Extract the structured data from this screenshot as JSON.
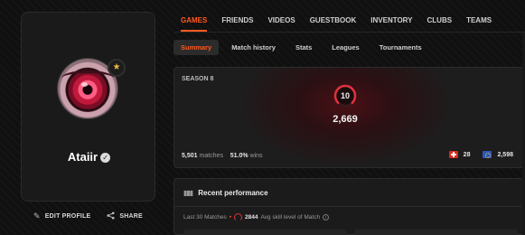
{
  "profile": {
    "name": "Ataiir",
    "level_badge_icon": "star",
    "actions": [
      {
        "label": "EDIT PROFILE",
        "icon": "pencil-icon"
      },
      {
        "label": "SHARE",
        "icon": "share-icon"
      }
    ]
  },
  "top_nav": {
    "tabs": [
      "GAMES",
      "FRIENDS",
      "VIDEOS",
      "GUESTBOOK",
      "INVENTORY",
      "CLUBS",
      "TEAMS"
    ],
    "active": "GAMES"
  },
  "sub_nav": {
    "tabs": [
      "Summary",
      "Match history",
      "Stats",
      "Leagues",
      "Tournaments"
    ],
    "active": "Summary"
  },
  "season": {
    "title": "SEASON 8",
    "skill_level": "10",
    "elo": "2,669",
    "matches_value": "5,501",
    "matches_label": "matches",
    "winrate_value": "51.0%",
    "winrate_label": "wins",
    "country_rank": "28",
    "region_rank": "2,598"
  },
  "recent": {
    "title": "Recent performance",
    "period": "Last 30 Matches",
    "avg_value": "2844",
    "avg_label": "Avg skill level of Match"
  },
  "colors": {
    "accent": "#ff5a1f",
    "skill_gauge": "#e0323d",
    "background": "#101010"
  }
}
